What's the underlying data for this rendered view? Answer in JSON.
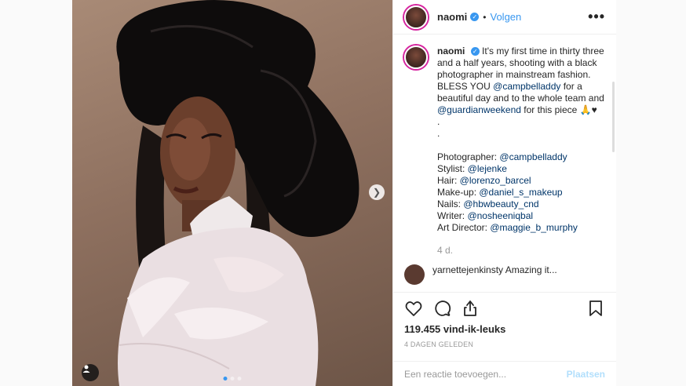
{
  "header": {
    "username": "naomi",
    "separator": "•",
    "follow_label": "Volgen",
    "more_label": "•••"
  },
  "caption": {
    "username": "naomi",
    "text_1": "It's my first time in thirty three and a half years, shooting with a black photographer in mainstream fashion.  BLESS YOU ",
    "mention_1": "@campbelladdy",
    "text_2": " for a beautiful day and to the whole team and ",
    "mention_2": "@guardianweekend",
    "text_3": " for this piece 🙏♥",
    "dot_1": ".",
    "dot_2": ".",
    "credits": [
      {
        "role": "Photographer: ",
        "handle": "@campbelladdy"
      },
      {
        "role": "Stylist: ",
        "handle": "@lejenke"
      },
      {
        "role": "Hair: ",
        "handle": "@lorenzo_barcel"
      },
      {
        "role": "Make-up: ",
        "handle": "@daniel_s_makeup"
      },
      {
        "role": "Nails: ",
        "handle": "@hbwbeauty_cnd"
      },
      {
        "role": "Writer: ",
        "handle": "@nosheeniqbal"
      },
      {
        "role": "Art Director: ",
        "handle": "@maggie_b_murphy"
      }
    ],
    "age": "4 d."
  },
  "next_comment": {
    "text": "yarnettejenkinsty Amazing it..."
  },
  "actions": {
    "like_icon": "heart-icon",
    "comment_icon": "comment-icon",
    "share_icon": "share-icon",
    "save_icon": "bookmark-icon"
  },
  "likes": "119.455 vind-ik-leuks",
  "date": "4 DAGEN GELEDEN",
  "comment_input": {
    "placeholder": "Een reactie toevoegen...",
    "post_label": "Plaatsen"
  },
  "colors": {
    "accent": "#3897f0",
    "link": "#003569",
    "post_disabled": "#b2dffc"
  },
  "carousel": {
    "next_icon": "chevron-right-icon",
    "slide_count": 3,
    "active_index": 0
  }
}
